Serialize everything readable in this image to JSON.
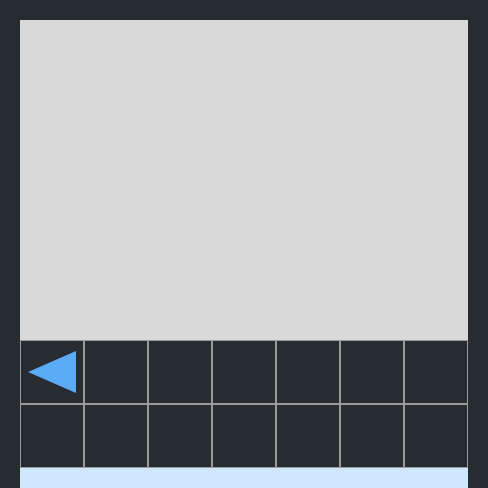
{
  "colors": {
    "background": "#272c30",
    "play_area": "#d9d9d9",
    "cell_border": "#9a9a9a",
    "arrow": "#5aabf5",
    "status_bar": "#cfe8ff"
  },
  "grid": {
    "rows": 2,
    "columns": 7,
    "cells": [
      {
        "icon": "left-arrow-icon"
      },
      {
        "icon": ""
      },
      {
        "icon": ""
      },
      {
        "icon": ""
      },
      {
        "icon": ""
      },
      {
        "icon": ""
      },
      {
        "icon": ""
      },
      {
        "icon": ""
      },
      {
        "icon": ""
      },
      {
        "icon": ""
      },
      {
        "icon": ""
      },
      {
        "icon": ""
      },
      {
        "icon": ""
      },
      {
        "icon": ""
      }
    ]
  }
}
